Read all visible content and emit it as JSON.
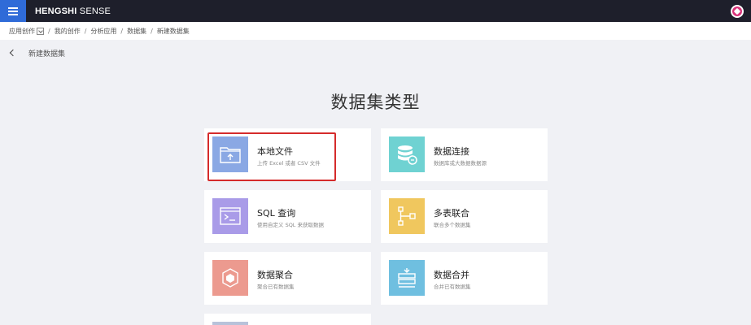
{
  "header": {
    "brand_bold": "HENGSHI",
    "brand_light": " SENSE"
  },
  "breadcrumb": {
    "items": [
      "应用创作",
      "我的创作",
      "分析应用",
      "数据集",
      "新建数据集"
    ],
    "separator": "/"
  },
  "page": {
    "back_label": "新建数据集",
    "title": "数据集类型"
  },
  "cards": [
    {
      "name": "本地文件",
      "desc": "上传 Excel 或者 CSV 文件",
      "color": "#8aa8e4",
      "icon": "folder-upload-icon",
      "selected": true
    },
    {
      "name": "数据连接",
      "desc": "数据库或大数据数据源",
      "color": "#6fd2d2",
      "icon": "database-icon",
      "selected": false
    },
    {
      "name": "SQL 查询",
      "desc": "使用自定义 SQL 来获取数据",
      "color": "#a99be8",
      "icon": "terminal-icon",
      "selected": false
    },
    {
      "name": "多表联合",
      "desc": "联合多个数据集",
      "color": "#f0c75e",
      "icon": "join-icon",
      "selected": false
    },
    {
      "name": "数据聚合",
      "desc": "聚合已有数据集",
      "color": "#ec9a8f",
      "icon": "cube-icon",
      "selected": false
    },
    {
      "name": "数据合并",
      "desc": "合并已有数据集",
      "color": "#6fbfe0",
      "icon": "merge-icon",
      "selected": false
    }
  ],
  "colors": {
    "topbar": "#1e1f2b",
    "menu_button": "#2f6bd8",
    "selection_outline": "#d52b2b",
    "page_bg": "#f0f1f5"
  }
}
